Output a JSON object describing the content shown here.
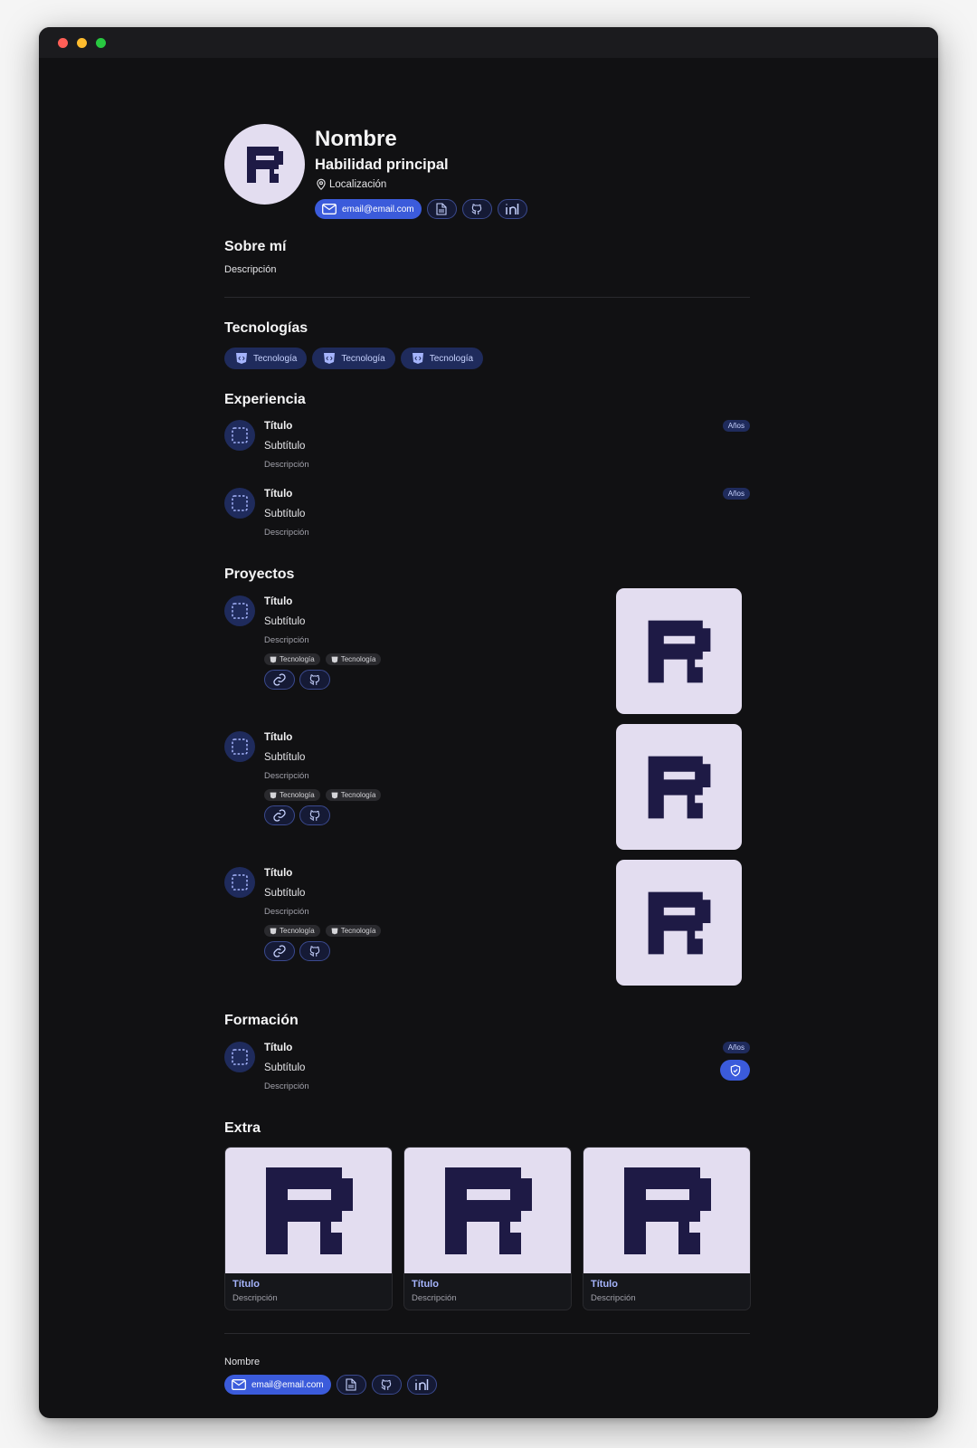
{
  "window": {
    "dots": [
      "#ff5f57",
      "#febc2e",
      "#28c840"
    ]
  },
  "profile": {
    "name": "Nombre",
    "skill": "Habilidad principal",
    "location": "Localización",
    "email": "email@email.com",
    "avatar_icon": "logo-r"
  },
  "about": {
    "title": "Sobre mí",
    "description": "Descripción"
  },
  "technologies": {
    "title": "Tecnologías",
    "items": [
      {
        "label": "Tecnología",
        "icon": "html-shield-icon"
      },
      {
        "label": "Tecnología",
        "icon": "html-shield-icon"
      },
      {
        "label": "Tecnología",
        "icon": "html-shield-icon"
      }
    ]
  },
  "experience": {
    "title": "Experiencia",
    "items": [
      {
        "title": "Título",
        "subtitle": "Subtítulo",
        "description": "Descripción",
        "years": "Años"
      },
      {
        "title": "Título",
        "subtitle": "Subtítulo",
        "description": "Descripción",
        "years": "Años"
      }
    ]
  },
  "projects": {
    "title": "Proyectos",
    "items": [
      {
        "title": "Título",
        "subtitle": "Subtítulo",
        "description": "Descripción",
        "tags": [
          "Tecnología",
          "Tecnología"
        ]
      },
      {
        "title": "Título",
        "subtitle": "Subtítulo",
        "description": "Descripción",
        "tags": [
          "Tecnología",
          "Tecnología"
        ]
      },
      {
        "title": "Título",
        "subtitle": "Subtítulo",
        "description": "Descripción",
        "tags": [
          "Tecnología",
          "Tecnología"
        ]
      }
    ]
  },
  "education": {
    "title": "Formación",
    "items": [
      {
        "title": "Título",
        "subtitle": "Subtítulo",
        "description": "Descripción",
        "years": "Años"
      }
    ]
  },
  "extra": {
    "title": "Extra",
    "items": [
      {
        "title": "Título",
        "description": "Descripción"
      },
      {
        "title": "Título",
        "description": "Descripción"
      },
      {
        "title": "Título",
        "description": "Descripción"
      }
    ]
  },
  "footer": {
    "name": "Nombre",
    "email": "email@email.com"
  },
  "colors": {
    "accent": "#3b5bdb",
    "background": "#111113",
    "chip": "#1f2b5c",
    "logo_bg": "#e3ddf0",
    "logo_fg": "#1e1a45"
  }
}
